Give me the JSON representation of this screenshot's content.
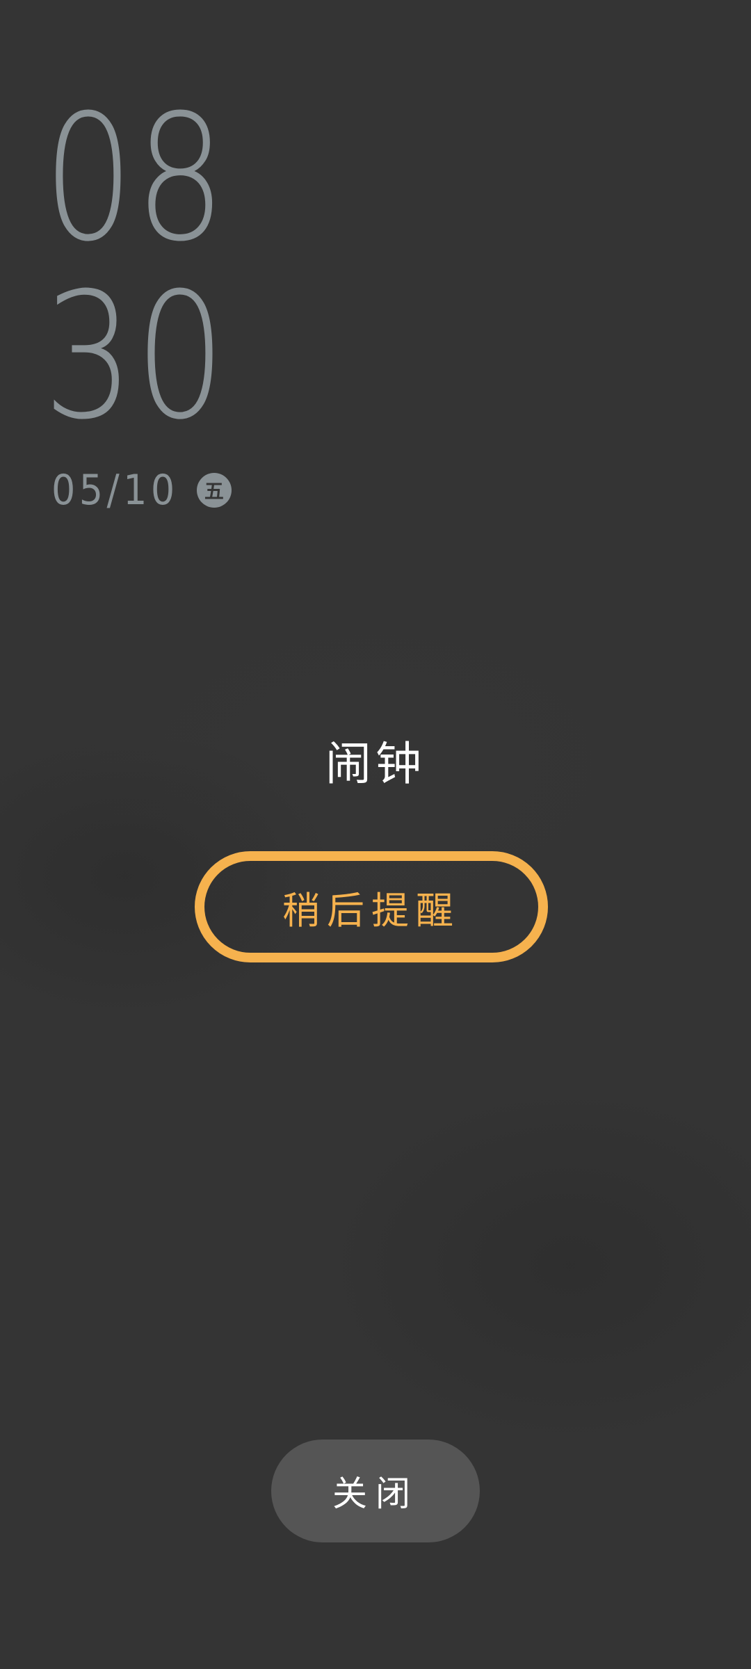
{
  "clock": {
    "hour": "08",
    "minute": "30"
  },
  "date": {
    "text": "05/10",
    "weekday": "五"
  },
  "alarm": {
    "label": "闹钟",
    "snooze_label": "稍后提醒",
    "close_label": "关闭"
  },
  "colors": {
    "background": "#343434",
    "clock_text": "#8a9296",
    "accent": "#f6b24e",
    "close_button": "#555555"
  }
}
